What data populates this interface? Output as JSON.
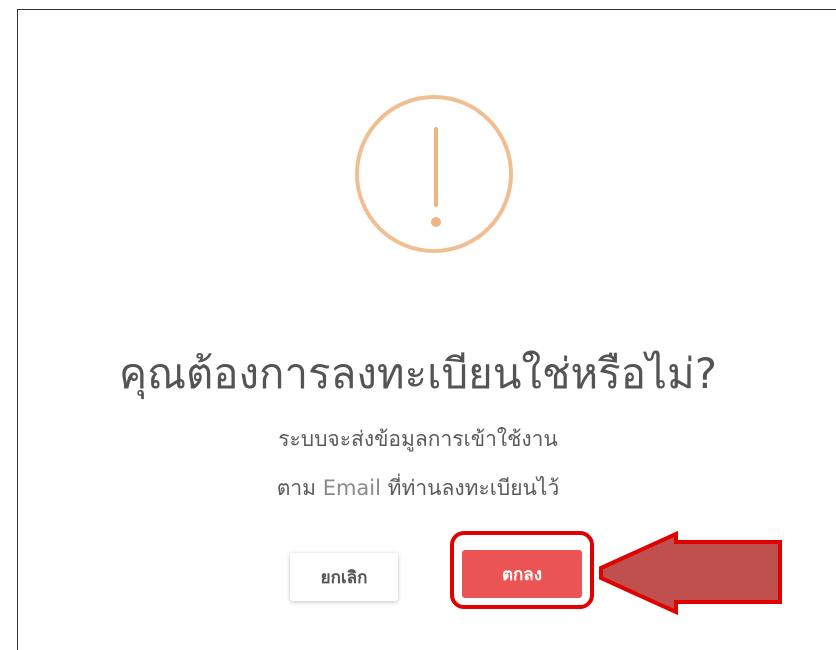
{
  "dialog": {
    "icon": "exclamation-circle-icon",
    "title": "คุณต้องการลงทะเบียนใช่หรือไม่?",
    "message_line1": "ระบบจะส่งข้อมูลการเข้าใช้งาน",
    "message_line2_prefix": "ตาม",
    "message_line2_email": "Email",
    "message_line2_suffix": "ที่ท่านลงทะเบียนไว้",
    "cancel_label": "ยกเลิก",
    "confirm_label": "ตกลง"
  },
  "annotation": {
    "arrow_icon": "left-arrow-icon",
    "arrow_color": "#c0504d",
    "highlight_color": "#e00000"
  },
  "colors": {
    "icon": "#efbf91",
    "confirm_button": "#ea5455",
    "title_text": "#545454"
  }
}
